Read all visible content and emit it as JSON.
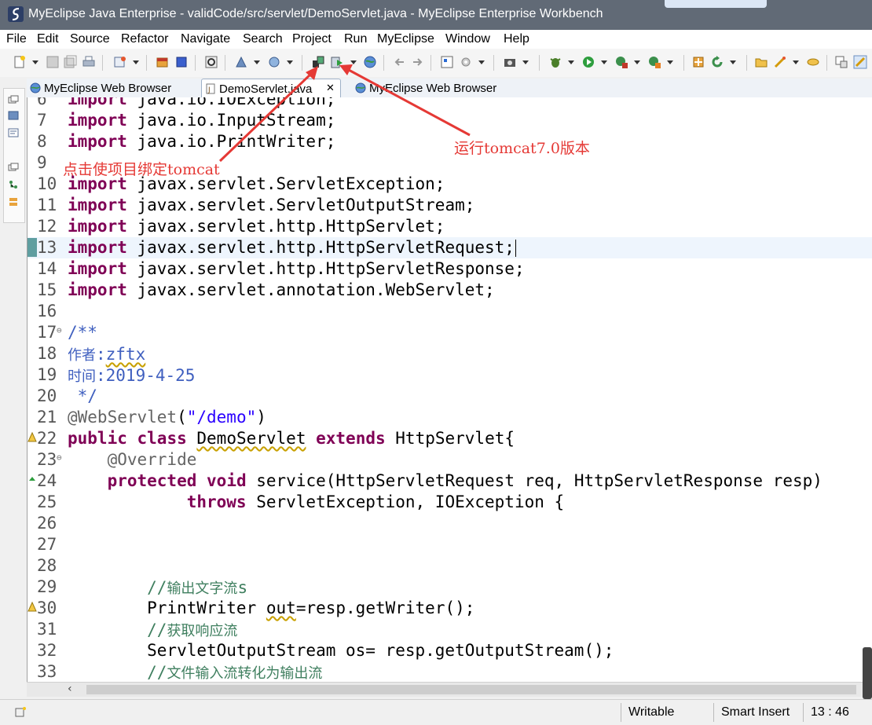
{
  "window": {
    "title": "MyEclipse Java Enterprise - validCode/src/servlet/DemoServlet.java - MyEclipse Enterprise Workbench"
  },
  "menu": [
    "File",
    "Edit",
    "Source",
    "Refactor",
    "Navigate",
    "Search",
    "Project",
    "Run",
    "MyEclipse",
    "Window",
    "Help"
  ],
  "tabs": [
    {
      "label": "MyEclipse Web Browser"
    },
    {
      "label": "DemoServlet.java",
      "active": true
    },
    {
      "label": "MyEclipse Web Browser"
    }
  ],
  "editor": {
    "lines": [
      {
        "n": "6",
        "text": "import java.io.IOException;"
      },
      {
        "n": "7",
        "text": "import java.io.InputStream;"
      },
      {
        "n": "8",
        "text": "import java.io.PrintWriter;"
      },
      {
        "n": "9",
        "text": ""
      },
      {
        "n": "10",
        "text": "import javax.servlet.ServletException;"
      },
      {
        "n": "11",
        "text": "import javax.servlet.ServletOutputStream;"
      },
      {
        "n": "12",
        "text": "import javax.servlet.http.HttpServlet;"
      },
      {
        "n": "13",
        "text": "import javax.servlet.http.HttpServletRequest;"
      },
      {
        "n": "14",
        "text": "import javax.servlet.http.HttpServletResponse;"
      },
      {
        "n": "15",
        "text": "import javax.servlet.annotation.WebServlet;"
      },
      {
        "n": "16",
        "text": ""
      },
      {
        "n": "17",
        "text": "/**"
      },
      {
        "n": "18",
        "text": "作者:zftx"
      },
      {
        "n": "19",
        "text": "时间:2019-4-25"
      },
      {
        "n": "20",
        "text": " */"
      },
      {
        "n": "21",
        "text": "@WebServlet(\"/demo\")"
      },
      {
        "n": "22",
        "text": "public class DemoServlet extends HttpServlet{"
      },
      {
        "n": "23",
        "text": "    @Override"
      },
      {
        "n": "24",
        "text": "    protected void service(HttpServletRequest req, HttpServletResponse resp)"
      },
      {
        "n": "25",
        "text": "            throws ServletException, IOException {"
      },
      {
        "n": "26",
        "text": ""
      },
      {
        "n": "27",
        "text": ""
      },
      {
        "n": "28",
        "text": ""
      },
      {
        "n": "29",
        "text": "        //输出文字流s"
      },
      {
        "n": "30",
        "text": "        PrintWriter out=resp.getWriter();"
      },
      {
        "n": "31",
        "text": "        //获取响应流"
      },
      {
        "n": "32",
        "text": "        ServletOutputStream os= resp.getOutputStream();"
      },
      {
        "n": "33",
        "text": "        //文件输入流转化为输出流"
      }
    ]
  },
  "annotations": {
    "bind_tomcat": "点击使项目绑定tomcat",
    "run_tomcat": "运行tomcat7.0版本"
  },
  "status": {
    "writable": "Writable",
    "insert_mode": "Smart Insert",
    "position": "13 : 46"
  },
  "colors": {
    "titlebar": "#616a76",
    "annotation": "#e53935",
    "keyword": "#7f0055",
    "string": "#2a00ff",
    "comment": "#3f7f5f",
    "javadoc": "#3f5fbf"
  }
}
